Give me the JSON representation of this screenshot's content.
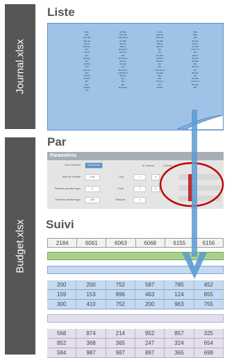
{
  "files": [
    {
      "label": "Journal.xlsx"
    },
    {
      "label": "Budget.xlsx"
    }
  ],
  "sections": {
    "liste": "Liste",
    "par": "Par",
    "suivi": "Suivi"
  },
  "liste_doc": {
    "columns": [
      "Date\ndate\ndate ate\ndate ab\n4mois\nabonne\nabc\n4mois\nnbre\nabonne\nabc\nabcdef\nnbre\nabonne\nabc\nabcdef\nabsolu\nabc\nabc\nabcdef\nabc",
      "de date\ndate ate\nL'abonnem\nde date\nabonne\ndate d\nabonnem\nabonne\nabc\nabonnem\nabonne\nde date\nabc\nabonnem\nL'abonnem\nabonne\nabc\nabc\nabc\nabonnem",
      "Code\ndate ab\ndate ate\nde date\ndate d\nabonne\nabc\nabc\nde date\nabcdef\nabonne\nabc\nabc\nL'abonnem\nde date\ndate\nabc\nabonne\nabc\nabcdef",
      "date\nDate\ndate\nabonne\ndate d\nde date\nL'abo LA\nabc\ndate d\nabonne\nde date\nabc\nabonne\nabc\nabonne\nabc\nde date\nL'abo LA\nde date\nabc"
    ]
  },
  "parametres": {
    "title": "Paramètres",
    "labels": [
      "Nom du fichier",
      "Nom de la feuille",
      "Première première ligne",
      "Première dernière ligne",
      "Lieu",
      "Code",
      "Méthode",
      "N° colonne",
      "Colonne"
    ],
    "values": [
      "Journal.xlsx",
      "Liste",
      "2",
      "200",
      "1",
      "2",
      "3",
      "A",
      "5"
    ]
  },
  "suivi": {
    "header": [
      "2184",
      "6061",
      "6063",
      "6068",
      "6155",
      "6156"
    ],
    "block1": [
      [
        "200",
        "200",
        "752",
        "587",
        "785",
        "452"
      ],
      [
        "159",
        "153",
        "896",
        "463",
        "124",
        "855"
      ],
      [
        "300",
        "410",
        "752",
        "200",
        "963",
        "755"
      ]
    ],
    "block2": [
      [
        "568",
        "874",
        "214",
        "952",
        "857",
        "325"
      ],
      [
        "852",
        "368",
        "365",
        "247",
        "324",
        "654"
      ],
      [
        "584",
        "987",
        "987",
        "897",
        "365",
        "698"
      ]
    ]
  },
  "colors": {
    "file_bar": "#565656",
    "doc": "#9fc3e6",
    "arrow": "#5b9bd5",
    "highlight": "#c00000",
    "green_band": "#a9d08e",
    "blue_band": "#c5d9f1",
    "purple_band": "#e4dfec"
  }
}
